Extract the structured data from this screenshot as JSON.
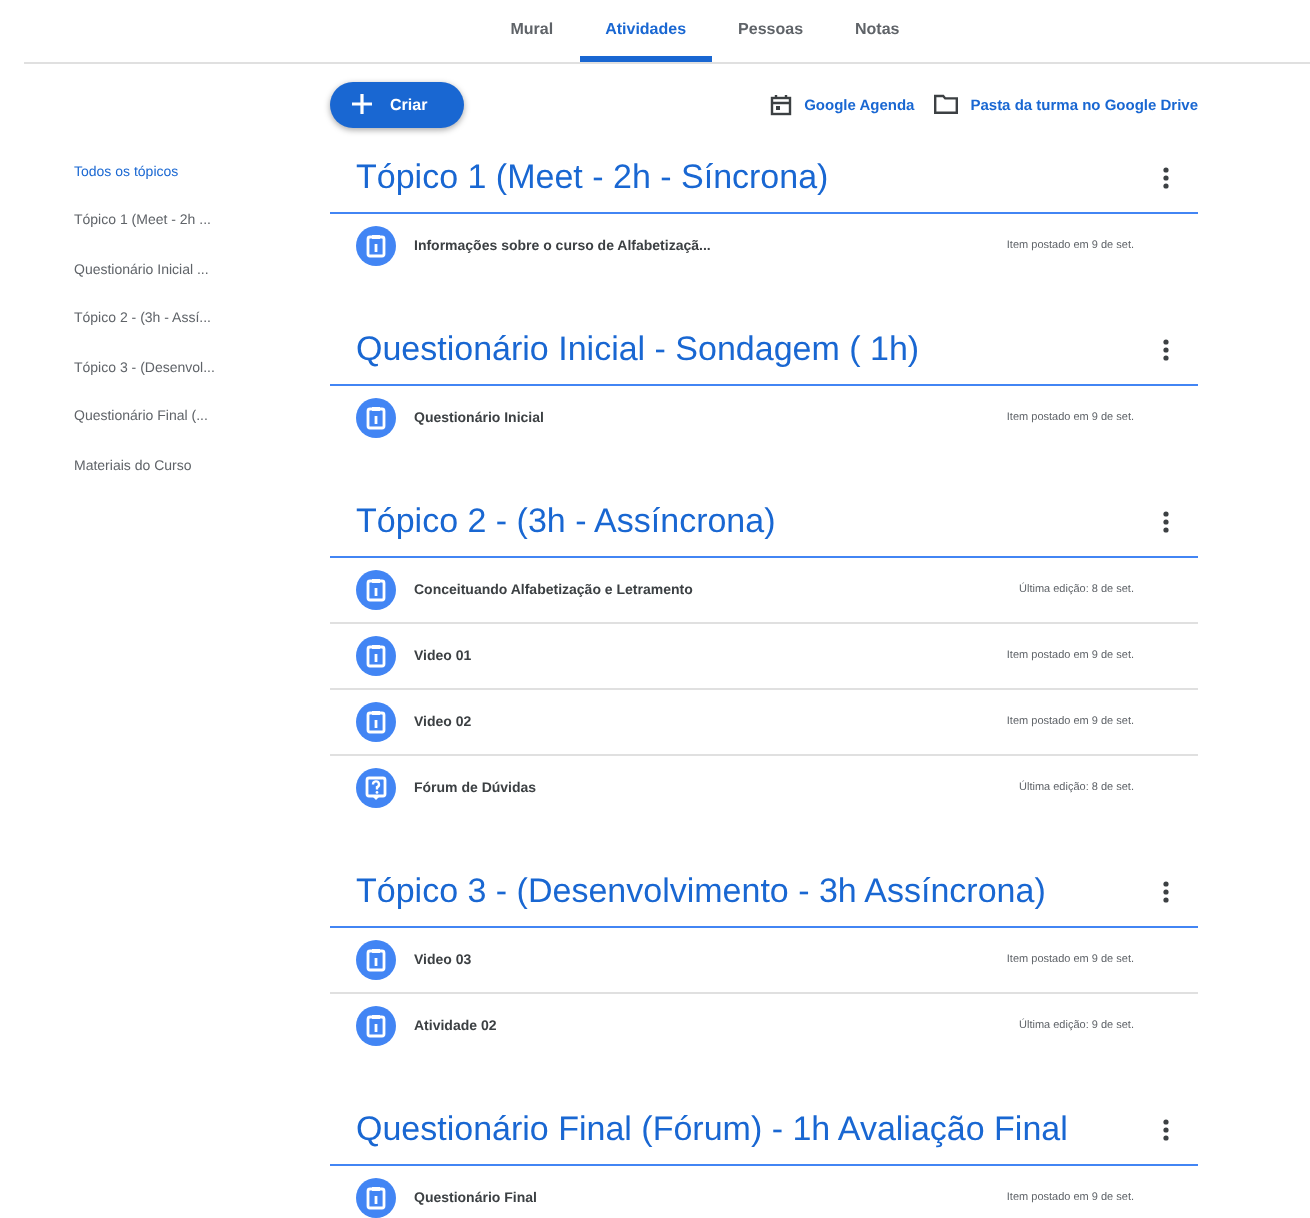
{
  "tabs": [
    {
      "label": "Mural",
      "selected": false
    },
    {
      "label": "Atividades",
      "selected": true
    },
    {
      "label": "Pessoas",
      "selected": false
    },
    {
      "label": "Notas",
      "selected": false
    }
  ],
  "create_button": "Criar",
  "links": [
    {
      "kind": "calendar",
      "label": "Google Agenda"
    },
    {
      "kind": "folder",
      "label": "Pasta da turma no Google Drive"
    }
  ],
  "sidebar": {
    "items": [
      {
        "label": "Todos os tópicos",
        "selected": true
      },
      {
        "label": "Tópico 1 (Meet - 2h ...",
        "selected": false
      },
      {
        "label": "Questionário Inicial ...",
        "selected": false
      },
      {
        "label": "Tópico 2 - (3h - Assí...",
        "selected": false
      },
      {
        "label": "Tópico 3 - (Desenvol...",
        "selected": false
      },
      {
        "label": "Questionário Final (...",
        "selected": false
      },
      {
        "label": "Materiais do Curso",
        "selected": false
      }
    ]
  },
  "topics": [
    {
      "title": "Tópico 1 (Meet - 2h - Síncrona)",
      "items": [
        {
          "kind": "material",
          "title": "Informações sobre o curso de Alfabetizaçã...",
          "meta": "Item postado em 9 de set."
        }
      ]
    },
    {
      "title": "Questionário Inicial - Sondagem ( 1h)",
      "items": [
        {
          "kind": "material",
          "title": "Questionário Inicial",
          "meta": "Item postado em 9 de set."
        }
      ]
    },
    {
      "title": "Tópico 2 - (3h - Assíncrona)",
      "items": [
        {
          "kind": "material",
          "title": "Conceituando Alfabetização e Letramento",
          "meta": "Última edição: 8 de set."
        },
        {
          "kind": "material",
          "title": "Video 01",
          "meta": "Item postado em 9 de set."
        },
        {
          "kind": "material",
          "title": "Video 02",
          "meta": "Item postado em 9 de set."
        },
        {
          "kind": "question",
          "title": "Fórum de Dúvidas",
          "meta": "Última edição: 8 de set."
        }
      ]
    },
    {
      "title": "Tópico 3 - (Desenvolvimento - 3h Assíncrona)",
      "items": [
        {
          "kind": "material",
          "title": "Video 03",
          "meta": "Item postado em 9 de set."
        },
        {
          "kind": "material",
          "title": "Atividade 02",
          "meta": "Última edição: 9 de set."
        }
      ]
    },
    {
      "title": "Questionário Final (Fórum) - 1h Avaliação Final",
      "items": [
        {
          "kind": "material",
          "title": "Questionário Final",
          "meta": "Item postado em 9 de set."
        }
      ]
    }
  ]
}
